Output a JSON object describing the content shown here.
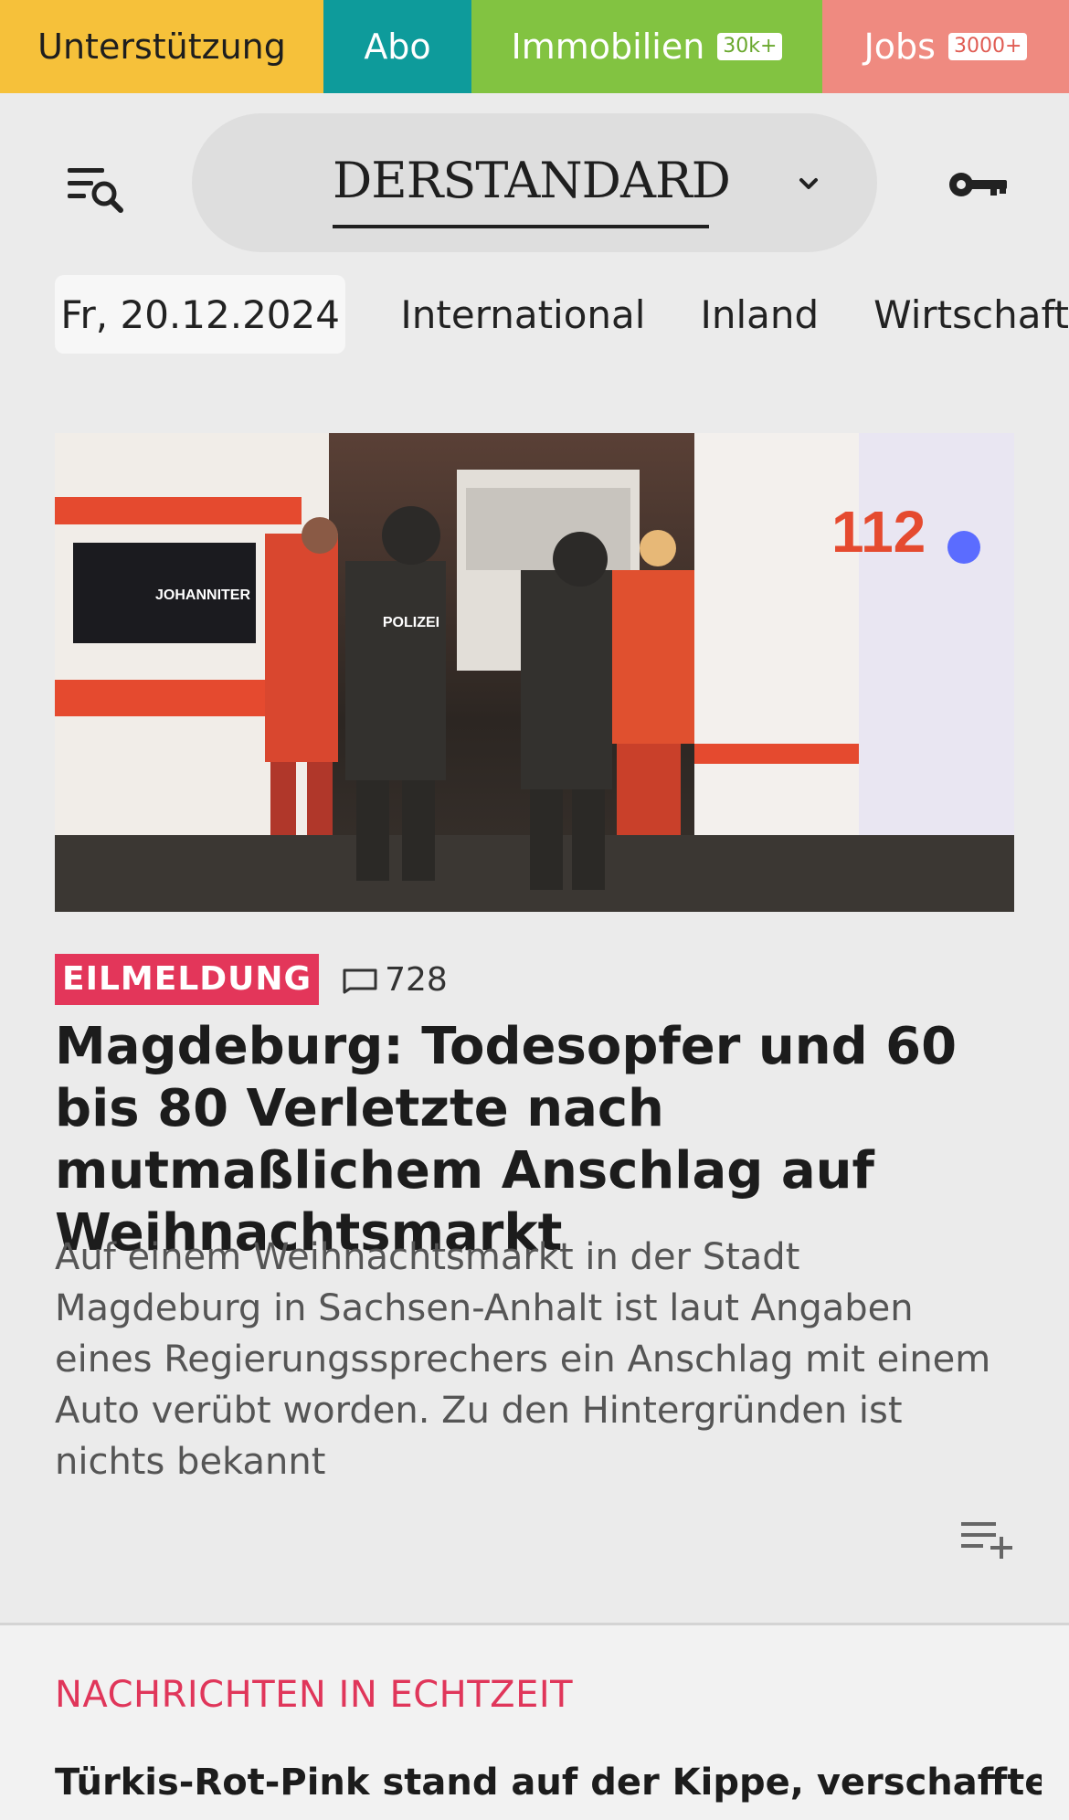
{
  "topbar": {
    "support_label": "Unterstützung",
    "abo_label": "Abo",
    "immo_label": "Immobilien",
    "immo_badge": "30k+",
    "jobs_label": "Jobs",
    "jobs_badge": "3000+",
    "colors": {
      "support": "#f6c13a",
      "abo": "#0e9b9b",
      "immo": "#82c341",
      "jobs": "#ef8a80"
    }
  },
  "header": {
    "logo_text": "DerStandard",
    "menu_icon": "menu-search-icon",
    "chevron_icon": "chevron-down-icon",
    "account_icon": "key-icon"
  },
  "nav": {
    "date": "Fr, 20.12.2024",
    "links": [
      "International",
      "Inland",
      "Wirtschaft"
    ]
  },
  "article": {
    "hero_alt": "Polizei und Rettungskräfte bei Einsatzfahrzeugen",
    "hero_text": {
      "ambulance": "JOHANNITER",
      "police": "POLIZEI",
      "number": "112"
    },
    "badge": "EILMELDUNG",
    "comment_count": "728",
    "headline": "Magdeburg: Todesopfer und 60 bis 80 Verletzte nach mutmaßlichem Anschlag auf Weihnachtsmarkt",
    "teaser": "Auf einem Weihnachtsmarkt in der Stadt Magdeburg in Sachsen-Anhalt ist laut Angaben eines Regierungssprechers ein Anschlag mit einem Auto verübt worden. Zu den Hintergründen ist nichts bekannt",
    "accent": "#e3365a"
  },
  "live": {
    "section_title": "NACHRICHTEN IN ECHTZEIT",
    "next_headline": "Türkis-Rot-Pink stand auf der Kippe, verschaffte"
  }
}
